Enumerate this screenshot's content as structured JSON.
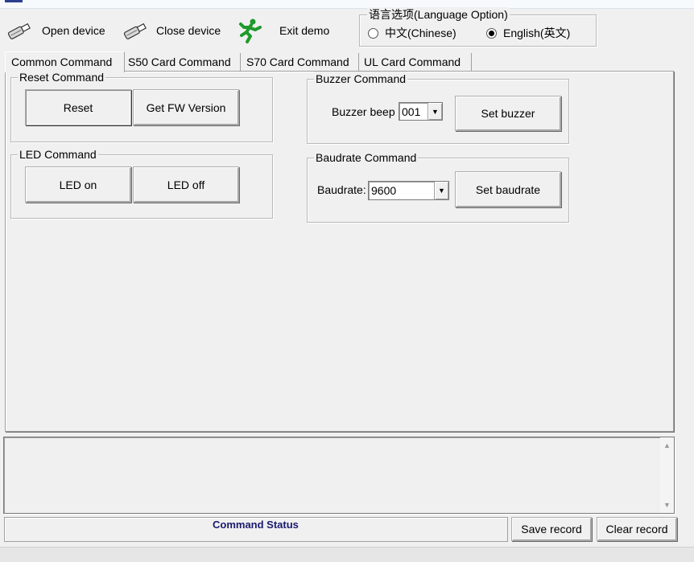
{
  "toolbar": {
    "open_device": "Open device",
    "close_device": "Close device",
    "exit_demo": "Exit demo"
  },
  "language": {
    "title": "语言选项(Language Option)",
    "chinese": "中文(Chinese)",
    "english": "English(英文)",
    "selected": "english"
  },
  "tabs": [
    {
      "label": "Common Command",
      "active": true
    },
    {
      "label": "S50 Card Command",
      "active": false
    },
    {
      "label": "S70 Card Command",
      "active": false
    },
    {
      "label": "UL Card Command",
      "active": false
    }
  ],
  "reset_group": {
    "title": "Reset Command",
    "reset": "Reset",
    "get_fw": "Get FW Version"
  },
  "led_group": {
    "title": "LED Command",
    "on": "LED on",
    "off": "LED off"
  },
  "buzzer_group": {
    "title": "Buzzer Command",
    "label": "Buzzer beep",
    "value": "001",
    "set": "Set buzzer"
  },
  "baud_group": {
    "title": "Baudrate Command",
    "label": "Baudrate:",
    "value": "9600",
    "set": "Set baudrate"
  },
  "status": {
    "label": "Command Status",
    "save": "Save record",
    "clear": "Clear record"
  }
}
